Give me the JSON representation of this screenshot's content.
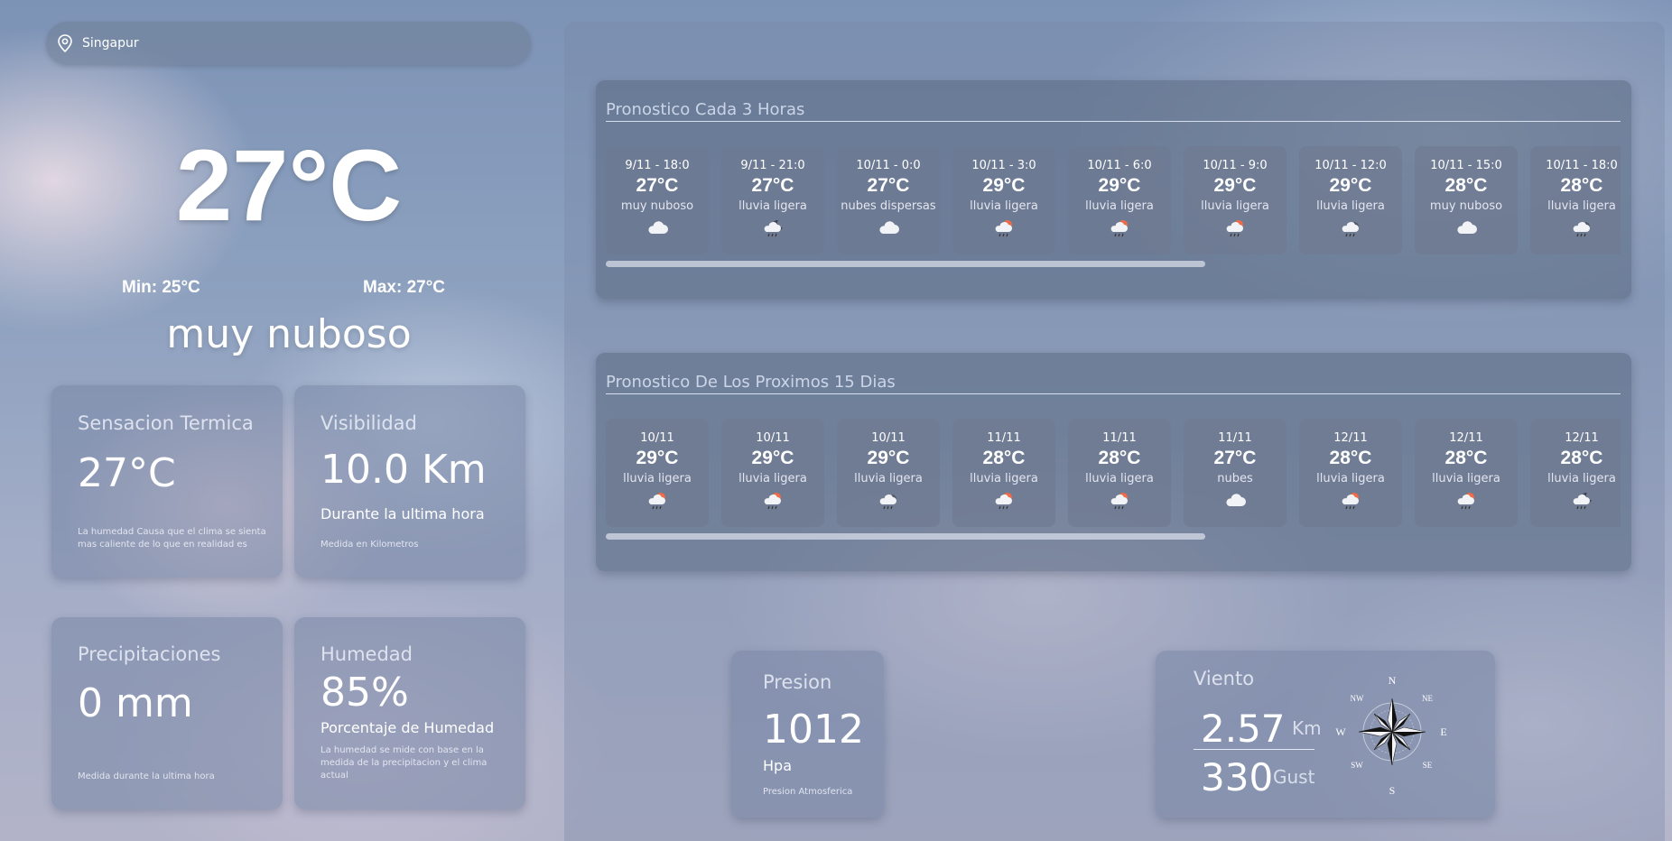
{
  "search": {
    "value": "Singapur",
    "icon": "location-pin-icon"
  },
  "current": {
    "temp": "27°C",
    "min": "Min: 25°C",
    "max": "Max: 27°C",
    "description": "muy nuboso"
  },
  "cards": {
    "feels_like": {
      "title": "Sensacion Termica",
      "value": "27°C",
      "note": "La humedad Causa que el clima se sienta mas caliente de lo que en realidad es"
    },
    "visibility": {
      "title": "Visibilidad",
      "value": "10.0 Km",
      "sub": "Durante la ultima hora",
      "note": "Medida en Kilometros"
    },
    "precipitation": {
      "title": "Precipitaciones",
      "value": "0 mm",
      "note": "Medida durante la ultima hora"
    },
    "humidity": {
      "title": "Humedad",
      "value": "85%",
      "sub": "Porcentaje de Humedad",
      "note": "La humedad se mide con base en la medida de la precipitacion y el clima actual"
    },
    "pressure": {
      "title": "Presion",
      "value": "1012",
      "unit": "Hpa",
      "note": "Presion Atmosferica"
    },
    "wind": {
      "title": "Viento",
      "speed": "2.57",
      "speed_unit": "Km",
      "gust": "330",
      "gust_label": "Gust",
      "compass_labels": {
        "n": "N",
        "ne": "NE",
        "e": "E",
        "se": "SE",
        "s": "S",
        "sw": "SW",
        "w": "W",
        "nw": "NW"
      }
    }
  },
  "hourly": {
    "title": "Pronostico Cada 3 Horas",
    "items": [
      {
        "time": "9/11 - 18:0",
        "temp": "27°C",
        "desc": "muy nuboso",
        "icon": "cloud-icon"
      },
      {
        "time": "9/11 - 21:0",
        "temp": "27°C",
        "desc": "lluvia ligera",
        "icon": "moon-rain-icon"
      },
      {
        "time": "10/11 - 0:0",
        "temp": "27°C",
        "desc": "nubes dispersas",
        "icon": "cloud-icon"
      },
      {
        "time": "10/11 - 3:0",
        "temp": "29°C",
        "desc": "lluvia ligera",
        "icon": "sun-rain-icon"
      },
      {
        "time": "10/11 - 6:0",
        "temp": "29°C",
        "desc": "lluvia ligera",
        "icon": "sun-rain-icon"
      },
      {
        "time": "10/11 - 9:0",
        "temp": "29°C",
        "desc": "lluvia ligera",
        "icon": "sun-rain-icon"
      },
      {
        "time": "10/11 - 12:0",
        "temp": "29°C",
        "desc": "lluvia ligera",
        "icon": "rain-cloud-icon"
      },
      {
        "time": "10/11 - 15:0",
        "temp": "28°C",
        "desc": "muy nuboso",
        "icon": "cloud-icon"
      },
      {
        "time": "10/11 - 18:0",
        "temp": "28°C",
        "desc": "lluvia ligera",
        "icon": "rain-cloud-icon"
      }
    ]
  },
  "daily": {
    "title": "Pronostico De Los Proximos 15 Dias",
    "items": [
      {
        "time": "10/11",
        "temp": "29°C",
        "desc": "lluvia ligera",
        "icon": "sun-rain-icon"
      },
      {
        "time": "10/11",
        "temp": "29°C",
        "desc": "lluvia ligera",
        "icon": "sun-rain-icon"
      },
      {
        "time": "10/11",
        "temp": "29°C",
        "desc": "lluvia ligera",
        "icon": "rain-cloud-icon"
      },
      {
        "time": "11/11",
        "temp": "28°C",
        "desc": "lluvia ligera",
        "icon": "sun-rain-icon"
      },
      {
        "time": "11/11",
        "temp": "28°C",
        "desc": "lluvia ligera",
        "icon": "sun-rain-icon"
      },
      {
        "time": "11/11",
        "temp": "27°C",
        "desc": "nubes",
        "icon": "cloud-icon"
      },
      {
        "time": "12/11",
        "temp": "28°C",
        "desc": "lluvia ligera",
        "icon": "sun-rain-icon"
      },
      {
        "time": "12/11",
        "temp": "28°C",
        "desc": "lluvia ligera",
        "icon": "sun-rain-icon"
      },
      {
        "time": "12/11",
        "temp": "28°C",
        "desc": "lluvia ligera",
        "icon": "moon-rain-icon"
      }
    ]
  }
}
